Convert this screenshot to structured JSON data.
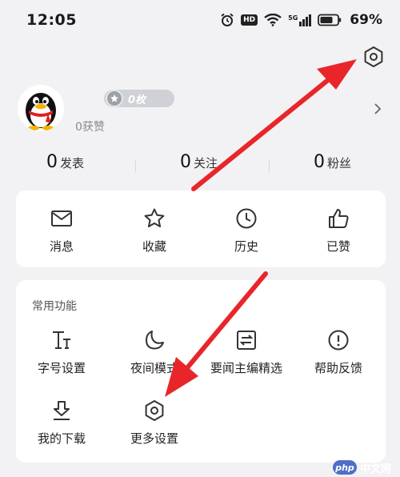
{
  "status_bar": {
    "time": "12:05",
    "hd": "HD",
    "network": "5G",
    "battery": "69%"
  },
  "profile": {
    "coin_text": "0枚",
    "likes_text": "0获赞"
  },
  "stats": [
    {
      "num": "0",
      "label": "发表"
    },
    {
      "num": "0",
      "label": "关注"
    },
    {
      "num": "0",
      "label": "粉丝"
    }
  ],
  "main_actions": [
    {
      "label": "消息",
      "icon": "mail-icon"
    },
    {
      "label": "收藏",
      "icon": "star-icon"
    },
    {
      "label": "历史",
      "icon": "clock-icon"
    },
    {
      "label": "已赞",
      "icon": "thumbs-up-icon"
    }
  ],
  "functions": {
    "title": "常用功能",
    "items": [
      {
        "label": "字号设置",
        "icon": "font-size-icon"
      },
      {
        "label": "夜间模式",
        "icon": "moon-icon"
      },
      {
        "label": "要闻主编精选",
        "icon": "editor-picks-icon"
      },
      {
        "label": "帮助反馈",
        "icon": "help-icon"
      },
      {
        "label": "我的下载",
        "icon": "download-icon"
      },
      {
        "label": "更多设置",
        "icon": "hexagon-settings-icon"
      }
    ]
  },
  "watermark": {
    "logo": "php",
    "text": "中文网"
  },
  "colors": {
    "background": "#f2f2f4",
    "card": "#ffffff",
    "annotation_arrow": "#e8262a"
  }
}
